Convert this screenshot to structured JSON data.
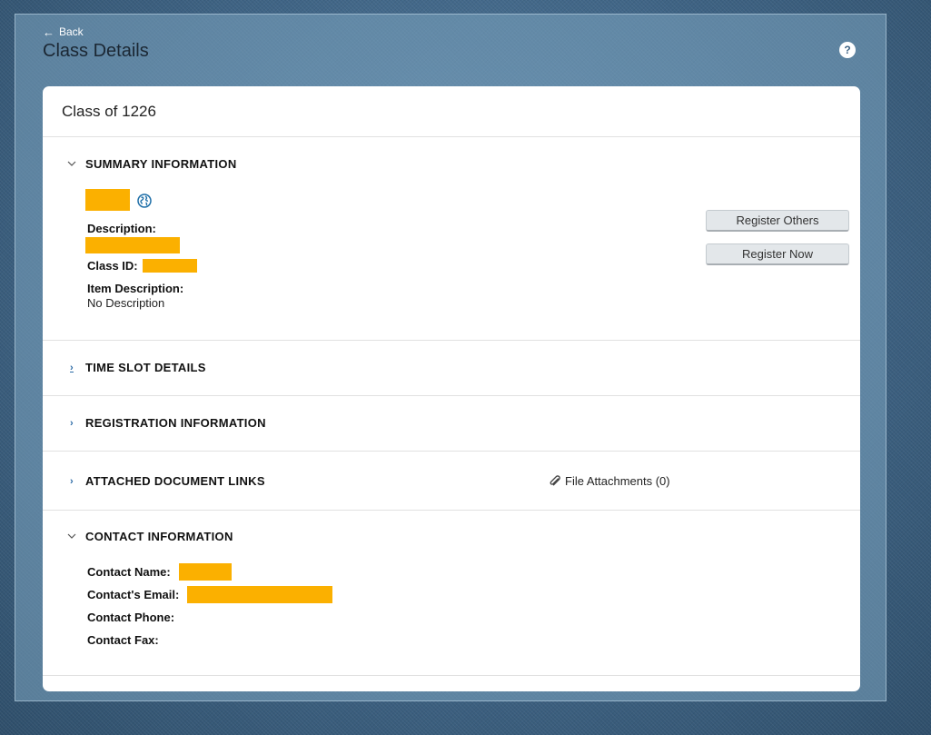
{
  "nav": {
    "back_label": "Back",
    "back_arrow": "←"
  },
  "page": {
    "title": "Class Details",
    "help_label": "?"
  },
  "card": {
    "title": "Class of 1226"
  },
  "sections": {
    "summary": {
      "title": "SUMMARY INFORMATION",
      "description_label": "Description:",
      "class_id_label": "Class ID:",
      "item_description_label": "Item Description:",
      "item_description_value": "No Description",
      "register_others_label": "Register Others",
      "register_now_label": "Register Now"
    },
    "time_slot": {
      "title": "TIME SLOT DETAILS"
    },
    "registration": {
      "title": "REGISTRATION INFORMATION"
    },
    "attached": {
      "title": "ATTACHED DOCUMENT LINKS",
      "file_attachments_label": "File Attachments (0)"
    },
    "contact": {
      "title": "CONTACT INFORMATION",
      "name_label": "Contact Name:",
      "email_label": "Contact's Email:",
      "phone_label": "Contact Phone:",
      "fax_label": "Contact Fax:"
    }
  },
  "icons": {
    "chevron_right": "›",
    "chevron_down": "⌄",
    "help": "question-icon",
    "globe": "globe-icon",
    "paperclip": "paperclip-icon"
  },
  "colors": {
    "redaction": "#fbb000",
    "background": "#3d5f7c",
    "card": "#ffffff",
    "link": "#2a6aa5"
  }
}
